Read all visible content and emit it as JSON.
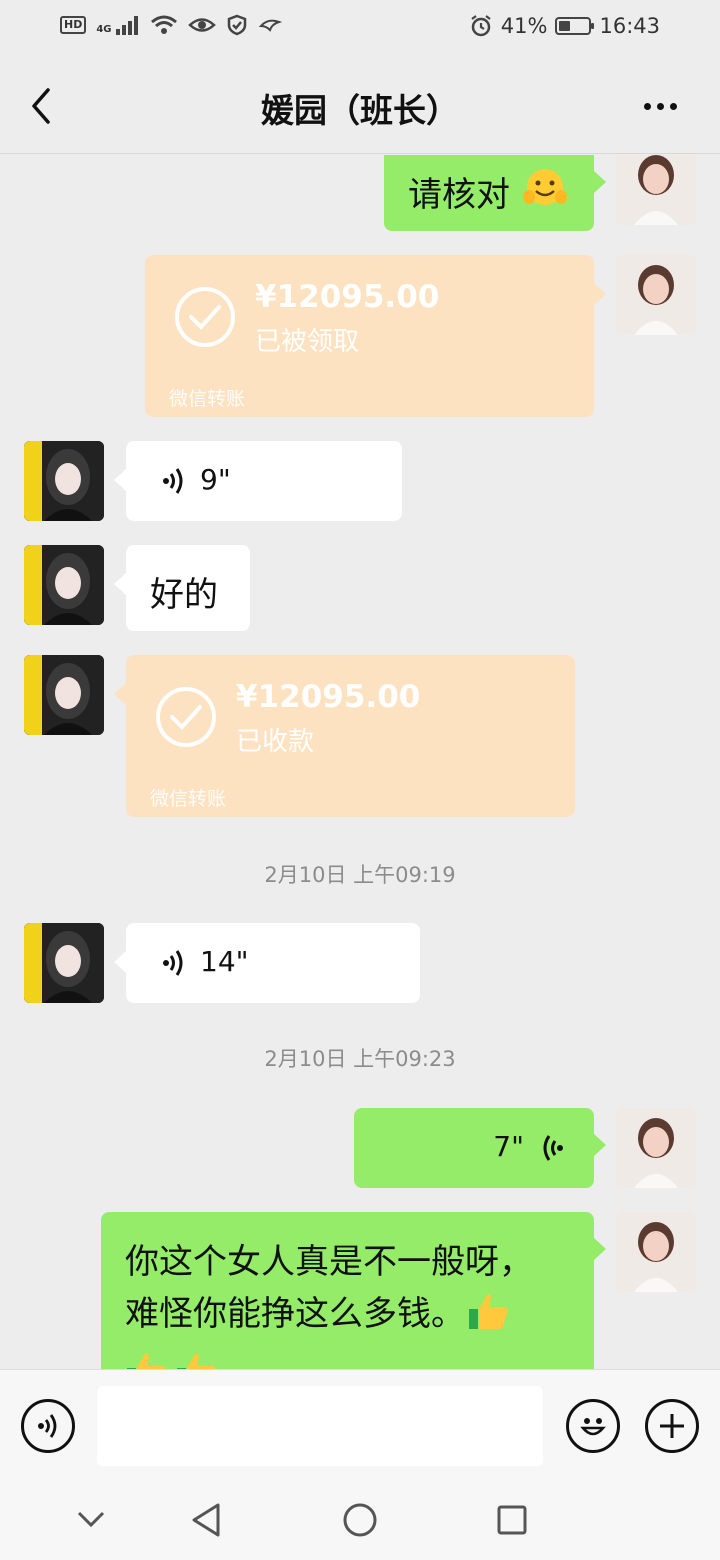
{
  "status_bar": {
    "left_badge": "HD",
    "network": "4G",
    "alarm_icon": "alarm-clock-icon",
    "battery_percent": "41%",
    "battery_level": 0.41,
    "time": "16:43"
  },
  "header": {
    "title": "媛园（班长）",
    "back_icon": "chevron-left-icon",
    "more_icon": "more-dots-icon"
  },
  "messages": [
    {
      "side": "right",
      "type": "text",
      "text": "请核对",
      "emoji": "hugging-face-emoji"
    },
    {
      "side": "right",
      "type": "transfer",
      "amount": "¥12095.00",
      "status": "已被领取",
      "footer": "微信转账"
    },
    {
      "side": "left",
      "type": "voice",
      "duration": "9\""
    },
    {
      "side": "left",
      "type": "text",
      "text": "好的"
    },
    {
      "side": "left",
      "type": "transfer",
      "amount": "¥12095.00",
      "status": "已收款",
      "footer": "微信转账"
    },
    {
      "type": "timestamp",
      "text": "2月10日 上午09:19"
    },
    {
      "side": "left",
      "type": "voice",
      "duration": "14\""
    },
    {
      "type": "timestamp",
      "text": "2月10日 上午09:23"
    },
    {
      "side": "right",
      "type": "voice",
      "duration": "7\""
    },
    {
      "side": "right",
      "type": "text",
      "line1": "你这个女人真是不一般呀，",
      "line2": "难怪你能挣这么多钱。",
      "emoji": "thumbs-up-emoji"
    }
  ],
  "input_bar": {
    "voice_icon": "voice-input-icon",
    "input_value": "",
    "emoji_icon": "smiley-icon",
    "plus_icon": "plus-icon"
  },
  "nav_bar": {
    "icons": [
      "chevron-down-icon",
      "back-triangle-icon",
      "home-circle-icon",
      "recents-square-icon"
    ]
  },
  "colors": {
    "background": "#ededed",
    "green_bubble": "#95ec69",
    "white_bubble": "#ffffff",
    "transfer_bubble": "#fde2c1",
    "timestamp_text": "#8c8c8c"
  }
}
